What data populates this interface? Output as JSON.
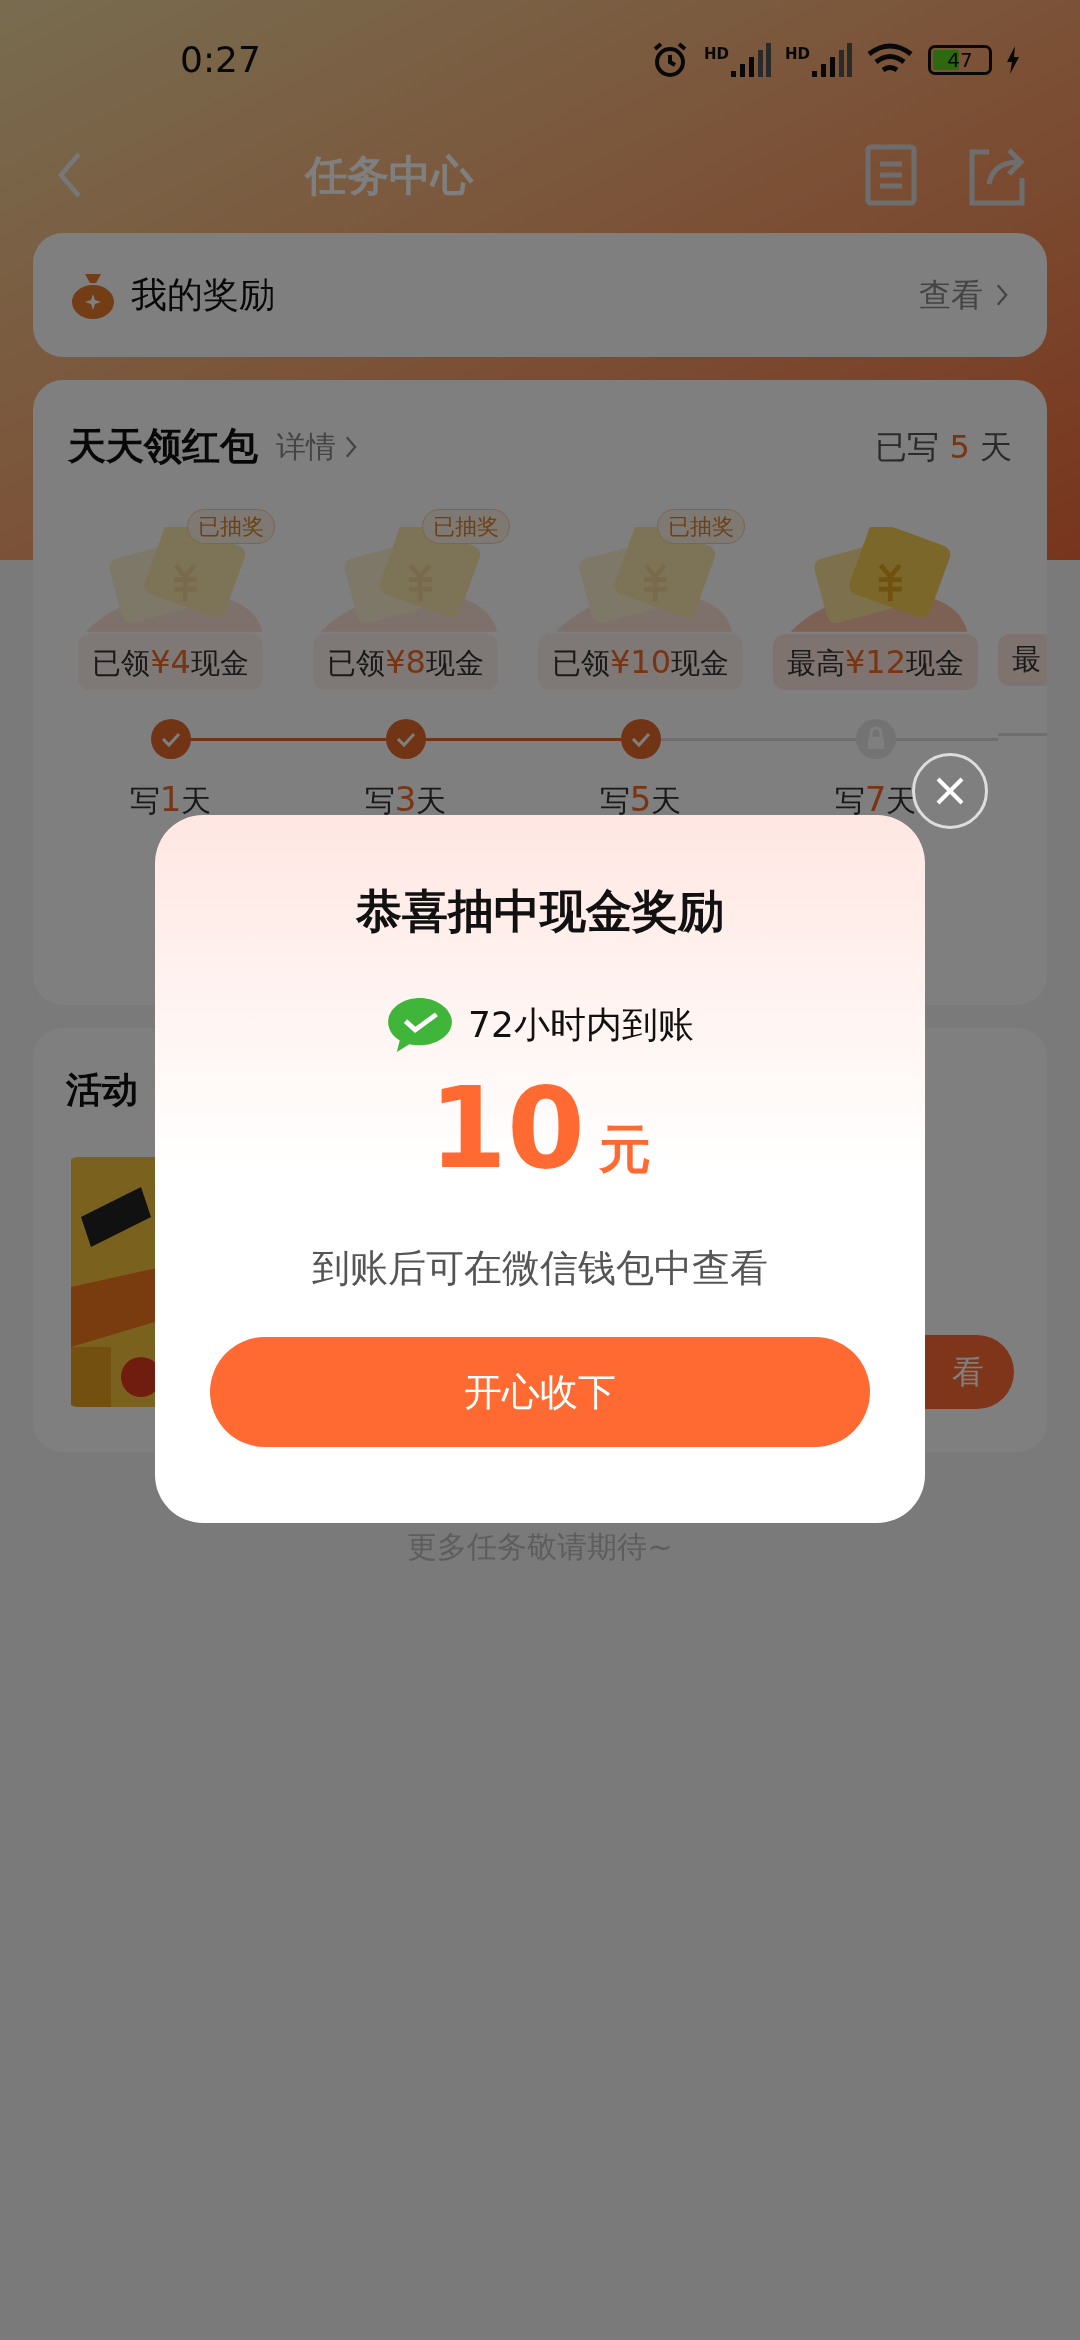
{
  "status_bar": {
    "time": "0:27",
    "sim_labels": [
      "HD",
      "HD"
    ],
    "battery": "47",
    "charging": true
  },
  "nav": {
    "title": "任务中心"
  },
  "my_rewards": {
    "title": "我的奖励",
    "link": "查看"
  },
  "daily": {
    "title": "天天领红包",
    "details": "详情",
    "progress_prefix": "已写",
    "progress_count": "5",
    "progress_unit": "天",
    "rewards": [
      {
        "badge": "已抽奖",
        "prefix": "已领",
        "amount": "¥4",
        "suffix": "现金",
        "done": true,
        "day_prefix": "写",
        "day_num": "1",
        "day_unit": "天"
      },
      {
        "badge": "已抽奖",
        "prefix": "已领",
        "amount": "¥8",
        "suffix": "现金",
        "done": true,
        "day_prefix": "写",
        "day_num": "3",
        "day_unit": "天"
      },
      {
        "badge": "已抽奖",
        "prefix": "已领",
        "amount": "¥10",
        "suffix": "现金",
        "done": true,
        "day_prefix": "写",
        "day_num": "5",
        "day_unit": "天"
      },
      {
        "prefix": "最高",
        "amount": "¥12",
        "suffix": "现金",
        "done": false,
        "day_prefix": "写",
        "day_num": "7",
        "day_unit": "天"
      },
      {
        "prefix": "最"
      }
    ]
  },
  "activity": {
    "title": "活动",
    "button": "看"
  },
  "footer": "更多任务敬请期待~",
  "dialog": {
    "title": "恭喜抽中现金奖励",
    "arrival": "72小时内到账",
    "amount": "10",
    "unit": "元",
    "note": "到账后可在微信钱包中查看",
    "button": "开心收下"
  }
}
